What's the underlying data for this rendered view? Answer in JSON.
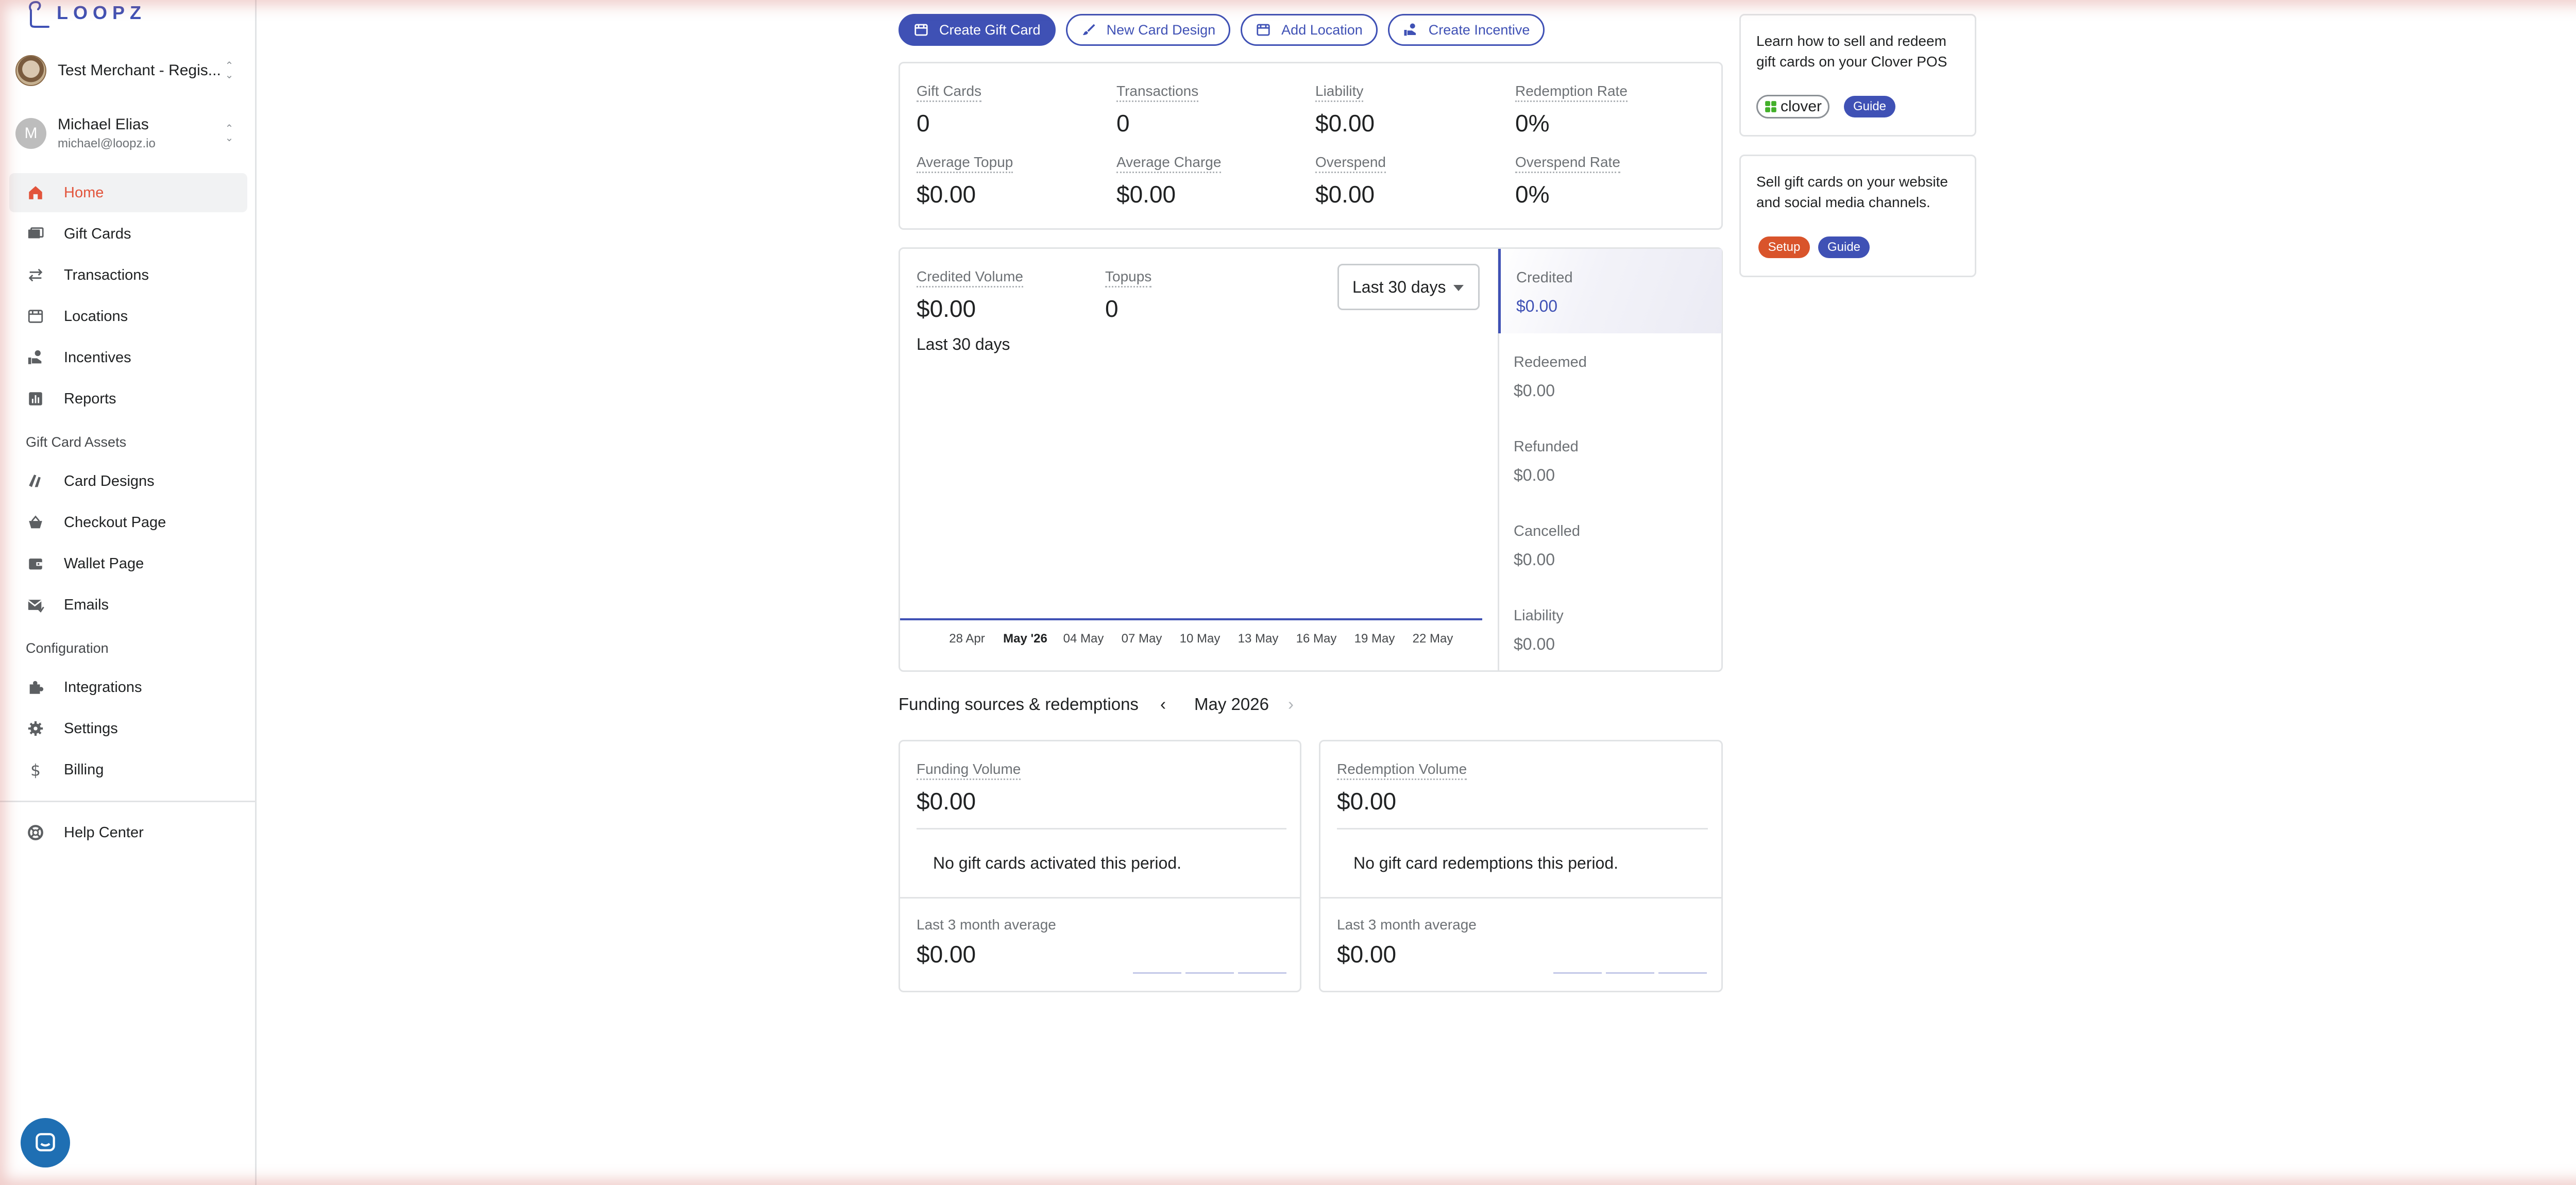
{
  "brand": {
    "logo_text": "LOOPZ"
  },
  "account": {
    "merchant_name": "Test Merchant - Regis...",
    "user_initial": "M",
    "user_name": "Michael Elias",
    "user_email": "michael@loopz.io"
  },
  "nav": {
    "main": [
      {
        "id": "home",
        "label": "Home",
        "icon": "home-icon",
        "active": true
      },
      {
        "id": "gift-cards",
        "label": "Gift Cards",
        "icon": "cards-icon"
      },
      {
        "id": "transactions",
        "label": "Transactions",
        "icon": "swap-icon"
      },
      {
        "id": "locations",
        "label": "Locations",
        "icon": "store-icon"
      },
      {
        "id": "incentives",
        "label": "Incentives",
        "icon": "hand-coin-icon"
      },
      {
        "id": "reports",
        "label": "Reports",
        "icon": "bar-chart-icon"
      }
    ],
    "assets_label": "Gift Card Assets",
    "assets": [
      {
        "id": "card-designs",
        "label": "Card Designs",
        "icon": "palette-icon"
      },
      {
        "id": "checkout-page",
        "label": "Checkout Page",
        "icon": "basket-icon"
      },
      {
        "id": "wallet-page",
        "label": "Wallet Page",
        "icon": "wallet-icon"
      },
      {
        "id": "emails",
        "label": "Emails",
        "icon": "mail-icon"
      }
    ],
    "config_label": "Configuration",
    "config": [
      {
        "id": "integrations",
        "label": "Integrations",
        "icon": "puzzle-icon"
      },
      {
        "id": "settings",
        "label": "Settings",
        "icon": "gear-icon"
      },
      {
        "id": "billing",
        "label": "Billing",
        "icon": "dollar-icon"
      }
    ],
    "help": {
      "label": "Help Center",
      "icon": "lifebuoy-icon"
    }
  },
  "toolbar": {
    "create_gift_card": "Create Gift Card",
    "new_card_design": "New Card Design",
    "add_location": "Add Location",
    "create_incentive": "Create Incentive"
  },
  "summary": {
    "gift_cards": {
      "label": "Gift Cards",
      "value": "0"
    },
    "transactions": {
      "label": "Transactions",
      "value": "0"
    },
    "liability": {
      "label": "Liability",
      "value": "$0.00"
    },
    "redemption_rate": {
      "label": "Redemption Rate",
      "value": "0%"
    },
    "average_topup": {
      "label": "Average Topup",
      "value": "$0.00"
    },
    "average_charge": {
      "label": "Average Charge",
      "value": "$0.00"
    },
    "overspend": {
      "label": "Overspend",
      "value": "$0.00"
    },
    "overspend_rate": {
      "label": "Overspend Rate",
      "value": "0%"
    }
  },
  "volume": {
    "credited_label": "Credited Volume",
    "credited_value": "$0.00",
    "period_caption": "Last 30 days",
    "topups_label": "Topups",
    "topups_value": "0",
    "range_select": "Last 30 days",
    "tabs": [
      {
        "label": "Credited",
        "value": "$0.00",
        "active": true
      },
      {
        "label": "Redeemed",
        "value": "$0.00"
      },
      {
        "label": "Refunded",
        "value": "$0.00"
      },
      {
        "label": "Cancelled",
        "value": "$0.00"
      },
      {
        "label": "Liability",
        "value": "$0.00"
      }
    ]
  },
  "chart_data": {
    "type": "line",
    "x_ticks": [
      "28 Apr",
      "May '26",
      "04 May",
      "07 May",
      "10 May",
      "13 May",
      "16 May",
      "19 May",
      "22 May"
    ],
    "bold_tick": "May '26",
    "series": [
      {
        "values": [
          0,
          0,
          0,
          0,
          0,
          0,
          0,
          0,
          0
        ]
      }
    ],
    "color": "#3f51b5"
  },
  "funding": {
    "title": "Funding sources & redemptions",
    "month": "May 2026",
    "funding_label": "Funding Volume",
    "funding_value": "$0.00",
    "funding_empty": "No gift cards activated this period.",
    "funding_avg_label": "Last 3 month average",
    "funding_avg_value": "$0.00",
    "redemption_label": "Redemption Volume",
    "redemption_value": "$0.00",
    "redemption_empty": "No gift card redemptions this period.",
    "redemption_avg_label": "Last 3 month average",
    "redemption_avg_value": "$0.00"
  },
  "info": {
    "clover_text": "Learn how to sell and redeem gift cards on your Clover POS",
    "clover_badge": "clover",
    "clover_guide": "Guide",
    "web_text": "Sell gift cards on your website and social media channels.",
    "web_setup": "Setup",
    "web_guide": "Guide"
  },
  "colors": {
    "accent": "#3f51b5",
    "active_nav": "#e2543b",
    "setup": "#d9542b"
  }
}
